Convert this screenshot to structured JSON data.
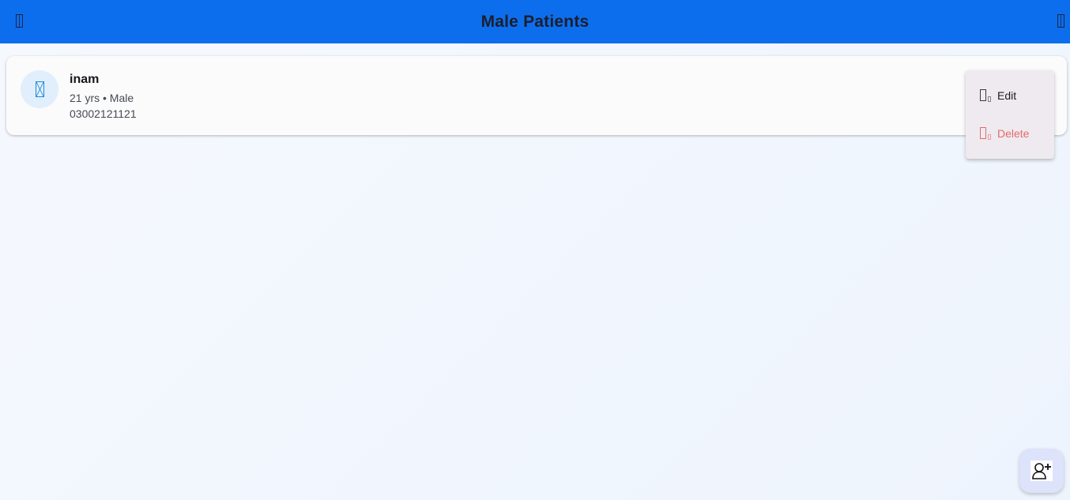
{
  "appbar": {
    "title": "Male Patients",
    "back_icon": "back-arrow-icon",
    "more_icon": "more-vert-icon",
    "color": "#0d6eed"
  },
  "patients": [
    {
      "name": "inam",
      "meta": "21 yrs • Male",
      "phone": "03002121121",
      "avatar_icon": "person-icon"
    }
  ],
  "menu": {
    "items": [
      {
        "label": "Edit",
        "icon": "edit-icon",
        "color": "#1c1c1c"
      },
      {
        "label": "Delete",
        "icon": "delete-icon",
        "color": "#e46a6a"
      }
    ]
  },
  "fab": {
    "icon": "add-person-icon",
    "color": "#dde3fb"
  }
}
